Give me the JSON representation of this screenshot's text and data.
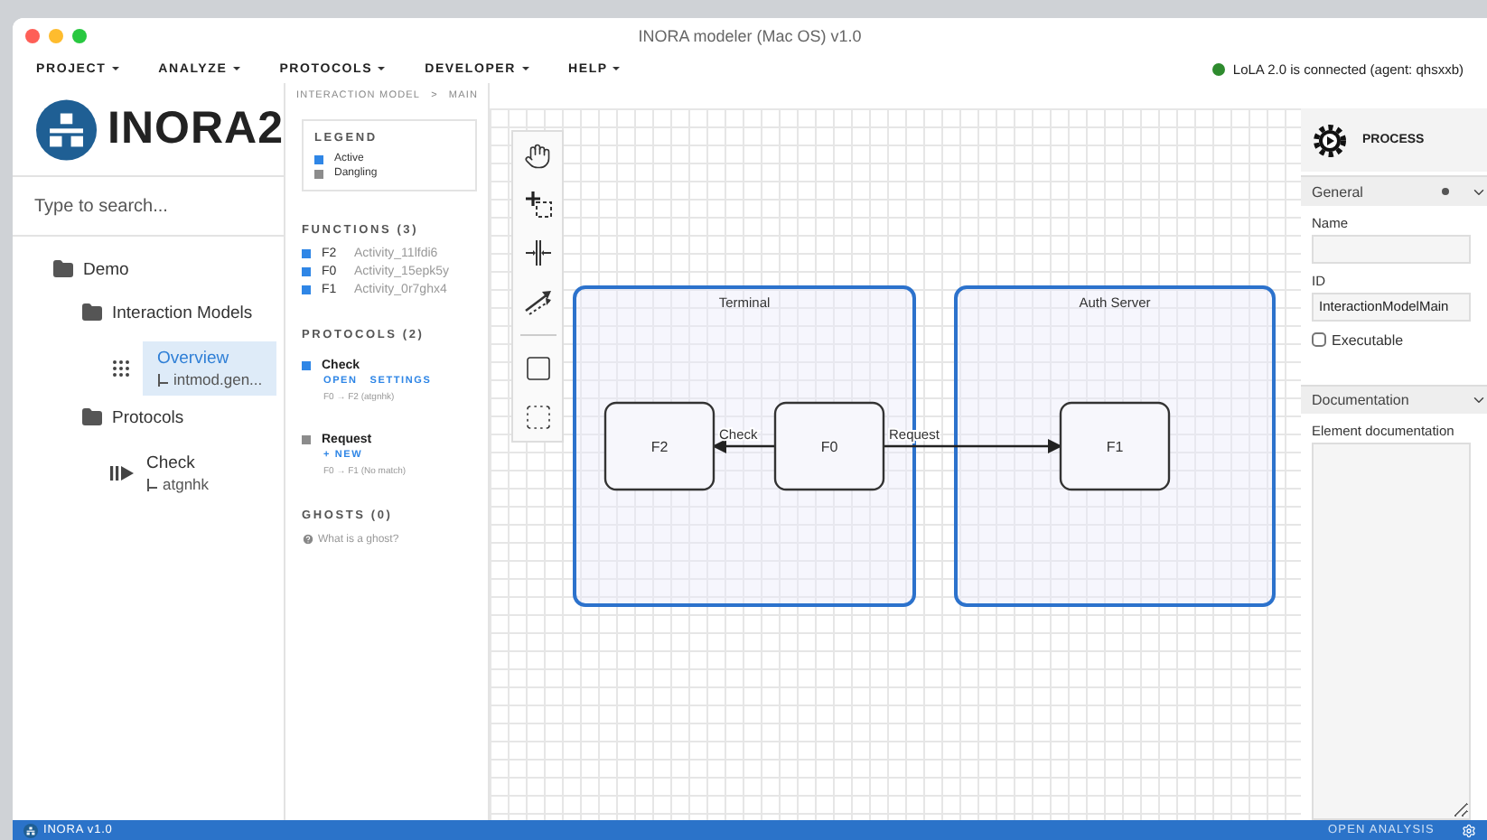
{
  "window": {
    "title": "INORA modeler (Mac OS) v1.0"
  },
  "menu": [
    "PROJECT",
    "ANALYZE",
    "PROTOCOLS",
    "DEVELOPER",
    "HELP"
  ],
  "connection": {
    "text": "LoLA 2.0 is connected (agent: qhsxxb)",
    "color": "#2e8b2e"
  },
  "logo": {
    "text": "INORA2"
  },
  "search": {
    "placeholder": "Type to search..."
  },
  "tree": [
    {
      "kind": "folder",
      "label": "Demo",
      "selected": false,
      "children": [
        {
          "kind": "folder",
          "label": "Interaction Models",
          "selected": false,
          "children": [
            {
              "kind": "model",
              "label": "Overview",
              "sub": "intmod.gen...",
              "selected": true
            }
          ]
        },
        {
          "kind": "folder",
          "label": "Protocols",
          "selected": false,
          "children": [
            {
              "kind": "protocol",
              "label": "Check",
              "sub": "atgnhk",
              "selected": false
            }
          ]
        }
      ]
    }
  ],
  "breadcrumb": {
    "items": [
      "INTERACTION MODEL",
      "MAIN"
    ],
    "separator": ">"
  },
  "legend": {
    "title": "LEGEND",
    "items": [
      {
        "label": "Active",
        "color": "#2f86e6"
      },
      {
        "label": "Dangling",
        "color": "#8c8c8c"
      }
    ]
  },
  "functions": {
    "title": "FUNCTIONS (3)",
    "items": [
      {
        "id": "F2",
        "name": "Activity_11lfdi6",
        "color": "#2f86e6"
      },
      {
        "id": "F0",
        "name": "Activity_15epk5y",
        "color": "#2f86e6"
      },
      {
        "id": "F1",
        "name": "Activity_0r7ghx4",
        "color": "#2f86e6"
      }
    ]
  },
  "protocols": {
    "title": "PROTOCOLS (2)",
    "items": [
      {
        "name": "Check",
        "color": "#2f86e6",
        "actions": [
          "OPEN",
          "SETTINGS"
        ],
        "route": "F0 → F2 (atgnhk)"
      },
      {
        "name": "Request",
        "color": "#8c8c8c",
        "actions": [
          "+ NEW"
        ],
        "route": "F0 → F1 (No match)"
      }
    ]
  },
  "ghosts": {
    "title": "GHOSTS (0)",
    "help": "What is a ghost?"
  },
  "diagram": {
    "containers": [
      {
        "label": "Terminal"
      },
      {
        "label": "Auth Server"
      }
    ],
    "nodes": [
      {
        "label": "F2"
      },
      {
        "label": "F0"
      },
      {
        "label": "F1"
      }
    ],
    "edges": [
      {
        "label": "Check"
      },
      {
        "label": "Request"
      }
    ]
  },
  "properties": {
    "title": "PROCESS",
    "sections": [
      {
        "title": "General",
        "expanded": true
      },
      {
        "title": "Documentation",
        "expanded": true
      }
    ],
    "name": {
      "label": "Name"
    },
    "id": {
      "label": "ID",
      "value": "InteractionModelMain"
    },
    "executable": {
      "label": "Executable",
      "checked": false
    },
    "documentation": {
      "label": "Element documentation"
    }
  },
  "status_bar": {
    "version": "INORA v1.0",
    "action": "OPEN ANALYSIS"
  }
}
